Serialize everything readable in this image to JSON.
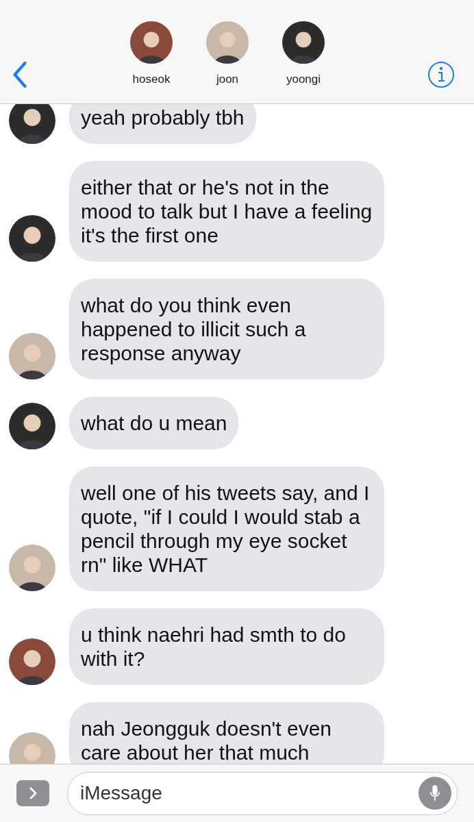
{
  "header": {
    "participants": [
      {
        "name": "hoseok",
        "color": "#8a4a3a"
      },
      {
        "name": "joon",
        "color": "#c9b8a8"
      },
      {
        "name": "yoongi",
        "color": "#2e2b2b"
      }
    ]
  },
  "messages": [
    {
      "text": "yeah probably tbh",
      "color": "#2e2b2b"
    },
    {
      "text": "either that or he's not in the mood to talk but I have a feeling it's the first one",
      "color": "#2e2b2b"
    },
    {
      "text": "what do you think even happened to illicit such a response anyway",
      "color": "#c9b8a8"
    },
    {
      "text": "what do u mean",
      "color": "#2e2b2b"
    },
    {
      "text": "well one of his tweets say, and I quote, \"if I could I would stab a pencil through my eye socket rn\" like WHAT",
      "color": "#c9b8a8"
    },
    {
      "text": "u think naehri had smth to do with it?",
      "color": "#8a4a3a"
    },
    {
      "text": "nah Jeongguk doesn't even care about her that much",
      "color": "#c9b8a8"
    }
  ],
  "composer": {
    "placeholder": "iMessage"
  }
}
